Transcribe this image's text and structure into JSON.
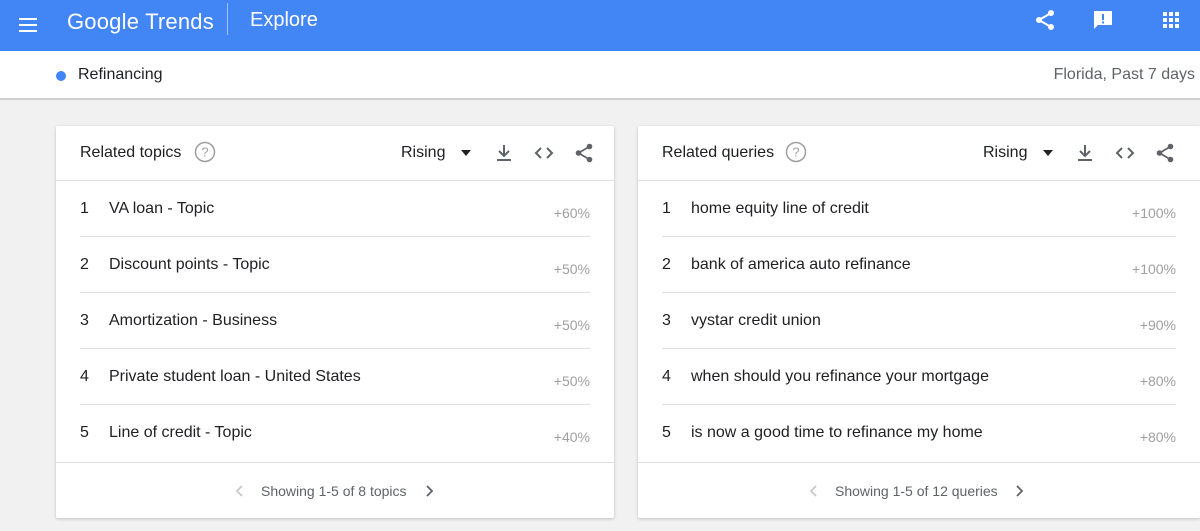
{
  "app": {
    "logo_google": "Google",
    "logo_trends": "Trends",
    "section": "Explore"
  },
  "topbar_icons": [
    "menu-icon",
    "share-icon",
    "feedback-icon",
    "apps-icon"
  ],
  "colors": {
    "brand": "#4285f4",
    "term_dot": "#4285f4"
  },
  "search": {
    "term": "Refinancing",
    "filters": "Florida, Past 7 days"
  },
  "related_topics": {
    "title": "Related topics",
    "sort": "Rising",
    "items": [
      {
        "rank": "1",
        "label": "VA loan - Topic",
        "value": "+60%"
      },
      {
        "rank": "2",
        "label": "Discount points - Topic",
        "value": "+50%"
      },
      {
        "rank": "3",
        "label": "Amortization - Business",
        "value": "+50%"
      },
      {
        "rank": "4",
        "label": "Private student loan - United States",
        "value": "+50%"
      },
      {
        "rank": "5",
        "label": "Line of credit - Topic",
        "value": "+40%"
      }
    ],
    "pager": "Showing 1-5 of 8 topics"
  },
  "related_queries": {
    "title": "Related queries",
    "sort": "Rising",
    "items": [
      {
        "rank": "1",
        "label": "home equity line of credit",
        "value": "+100%"
      },
      {
        "rank": "2",
        "label": "bank of america auto refinance",
        "value": "+100%"
      },
      {
        "rank": "3",
        "label": "vystar credit union",
        "value": "+90%"
      },
      {
        "rank": "4",
        "label": "when should you refinance your mortgage",
        "value": "+80%"
      },
      {
        "rank": "5",
        "label": "is now a good time to refinance my home",
        "value": "+80%"
      }
    ],
    "pager": "Showing 1-5 of 12 queries"
  }
}
